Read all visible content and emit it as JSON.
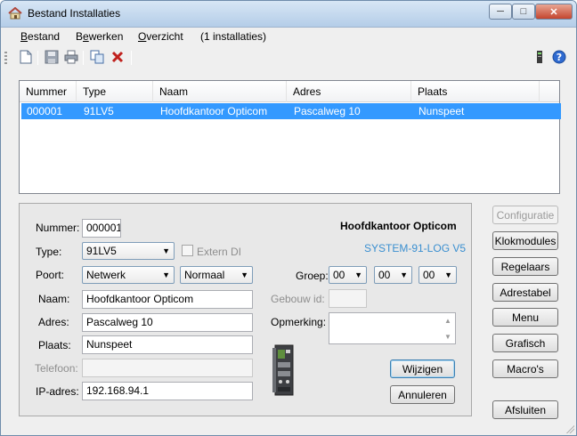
{
  "window": {
    "title": "Bestand Installaties"
  },
  "menu": {
    "items": [
      {
        "label": "Bestand",
        "accel": "B"
      },
      {
        "label": "Bewerken",
        "accel": "e"
      },
      {
        "label": "Overzicht",
        "accel": "O"
      },
      {
        "label": "(1 installaties)"
      }
    ]
  },
  "toolbar": {
    "icons": [
      "new-document-icon",
      "save-icon",
      "print-icon",
      "copy-icon",
      "delete-icon",
      "device-icon",
      "help-icon"
    ]
  },
  "list": {
    "columns": [
      "Nummer",
      "Type",
      "Naam",
      "Adres",
      "Plaats"
    ],
    "rows": [
      [
        "000001",
        "91LV5",
        "Hoofdkantoor Opticom",
        "Pascalweg 10",
        "Nunspeet"
      ]
    ],
    "selected_row": 0
  },
  "form": {
    "nummer_label": "Nummer:",
    "nummer_value": "000001",
    "type_label": "Type:",
    "type_value": "91LV5",
    "extern_di_label": "Extern DI",
    "poort_label": "Poort:",
    "poort_value": "Netwerk",
    "poort_mode_value": "Normaal",
    "naam_label": "Naam:",
    "naam_value": "Hoofdkantoor Opticom",
    "adres_label": "Adres:",
    "adres_value": "Pascalweg 10",
    "plaats_label": "Plaats:",
    "plaats_value": "Nunspeet",
    "telefoon_label": "Telefoon:",
    "telefoon_value": "",
    "ip_label": "IP-adres:",
    "ip_value": "192.168.94.1",
    "header_name": "Hoofdkantoor Opticom",
    "header_system": "SYSTEM-91-LOG V5",
    "groep_label": "Groep:",
    "groep_values": [
      "00",
      "00",
      "00"
    ],
    "gebouw_label": "Gebouw id:",
    "gebouw_value": "",
    "opmerking_label": "Opmerking:",
    "opmerking_value": "",
    "wijzigen": "Wijzigen",
    "annuleren": "Annuleren"
  },
  "side_buttons": {
    "configuratie": "Configuratie",
    "klokmodules": "Klokmodules",
    "regelaars": "Regelaars",
    "adrestabel": "Adrestabel",
    "menu": "Menu",
    "grafisch": "Grafisch",
    "macros": "Macro's",
    "afsluiten": "Afsluiten"
  },
  "colors": {
    "selection": "#3399ff",
    "system_label": "#3a8fd0",
    "titlebar": "#c4d8ee"
  }
}
